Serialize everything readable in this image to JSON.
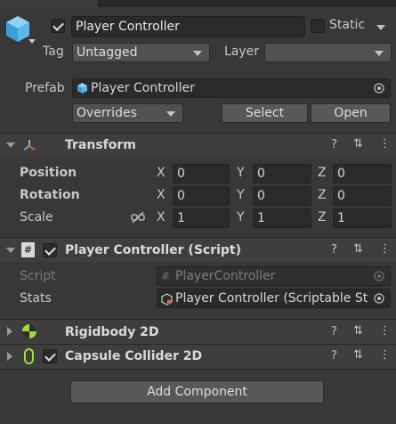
{
  "header": {
    "active_checked": true,
    "name": "Player Controller",
    "static_label": "Static",
    "tag_label": "Tag",
    "tag_value": "Untagged",
    "layer_label": "Layer",
    "layer_value": "",
    "prefab_label": "Prefab",
    "prefab_value": "Player Controller",
    "overrides_label": "Overrides",
    "select_label": "Select",
    "open_label": "Open"
  },
  "transform": {
    "title": "Transform",
    "rows": [
      {
        "label": "Position",
        "x": "0",
        "y": "0",
        "z": "0"
      },
      {
        "label": "Rotation",
        "x": "0",
        "y": "0",
        "z": "0"
      },
      {
        "label": "Scale",
        "x": "1",
        "y": "1",
        "z": "1"
      }
    ],
    "axis": {
      "x": "X",
      "y": "Y",
      "z": "Z"
    }
  },
  "script_component": {
    "title": "Player Controller (Script)",
    "enabled": true,
    "script_label": "Script",
    "script_value": "PlayerController",
    "stats_label": "Stats",
    "stats_value": "Player Controller (Scriptable St"
  },
  "rigidbody": {
    "title": "Rigidbody 2D"
  },
  "capsule": {
    "title": "Capsule Collider 2D",
    "enabled": true
  },
  "add_component_label": "Add Component",
  "colors": {
    "background": "#383838",
    "header": "#3e3e3e",
    "field": "#2a2a2a",
    "button": "#585858"
  }
}
